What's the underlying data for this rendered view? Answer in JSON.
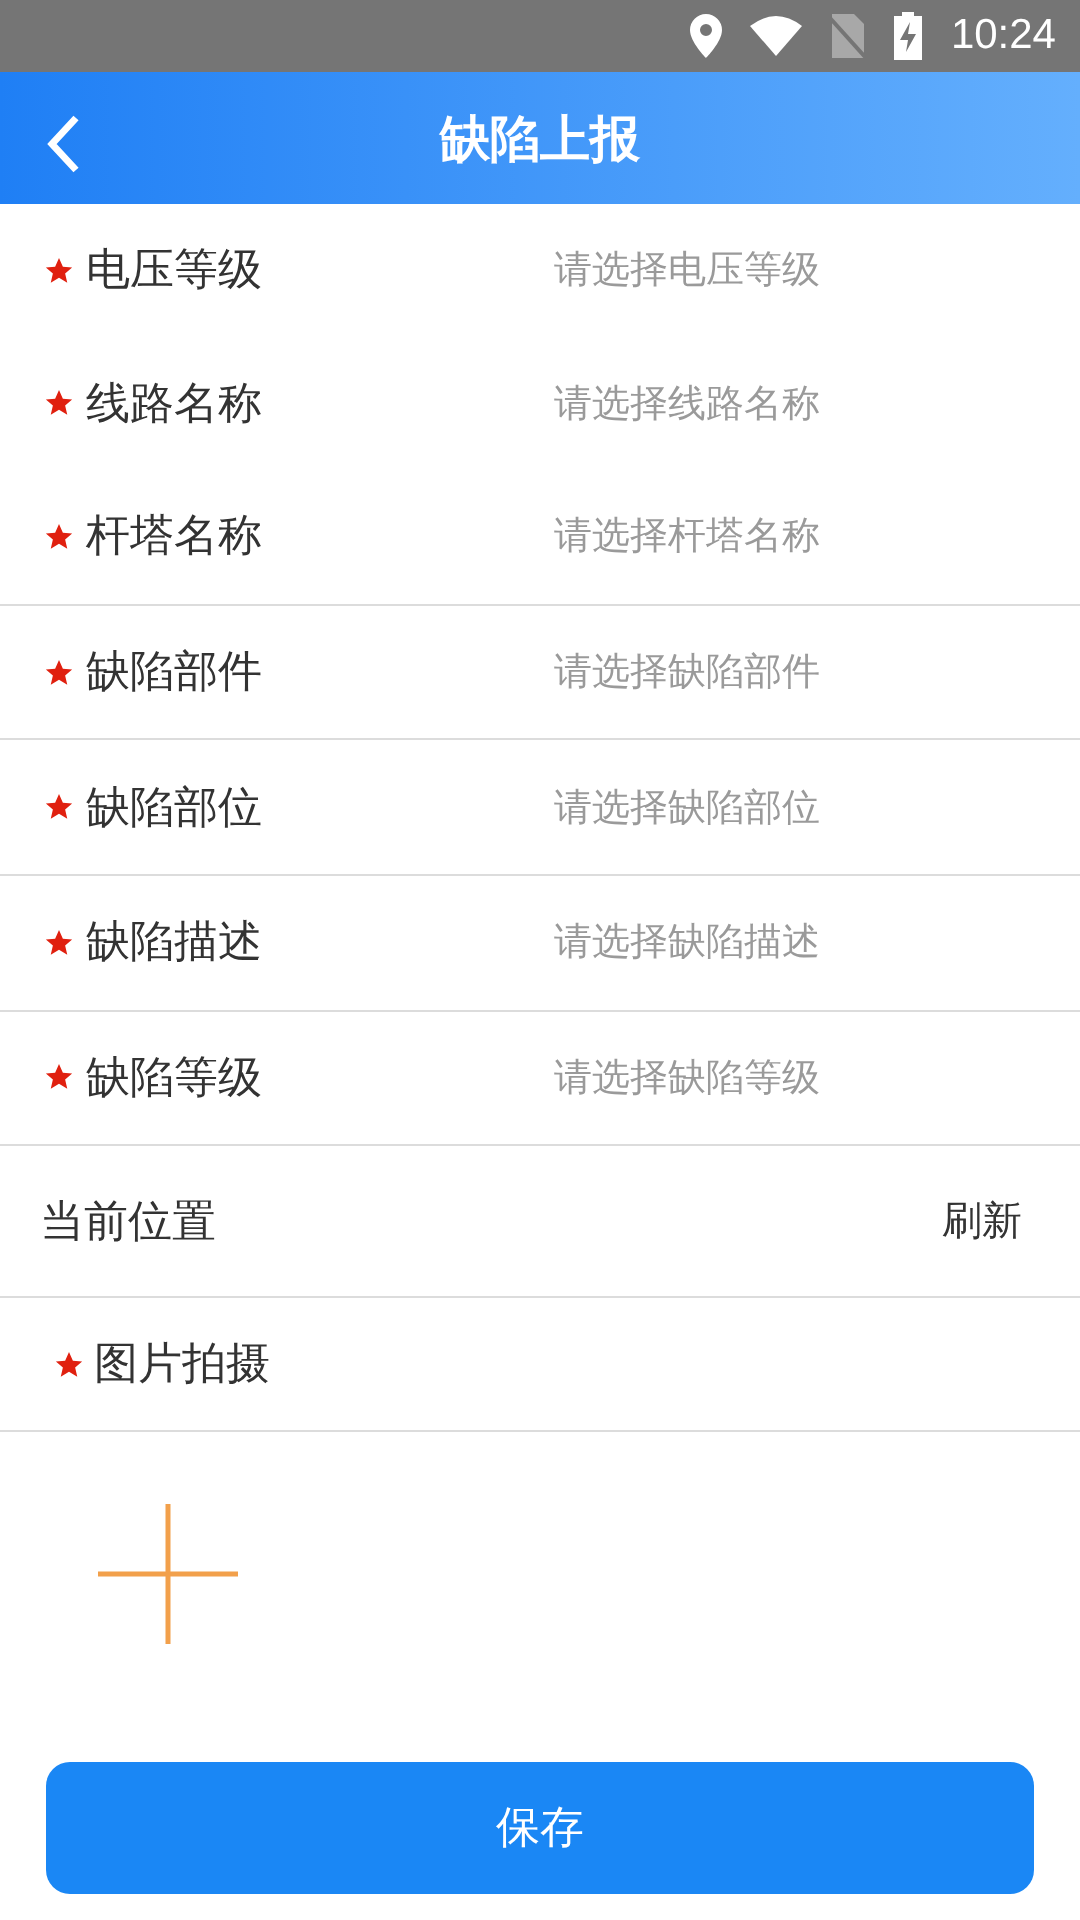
{
  "status_bar": {
    "time": "10:24"
  },
  "header": {
    "title": "缺陷上报"
  },
  "field_groups": [
    {
      "fields": [
        {
          "label": "电压等级",
          "required": true,
          "placeholder": "请选择电压等级"
        },
        {
          "label": "线路名称",
          "required": true,
          "placeholder": "请选择线路名称"
        },
        {
          "label": "杆塔名称",
          "required": true,
          "placeholder": "请选择杆塔名称"
        }
      ]
    },
    {
      "fields": [
        {
          "label": "缺陷部件",
          "required": true,
          "placeholder": "请选择缺陷部件"
        }
      ]
    },
    {
      "fields": [
        {
          "label": "缺陷部位",
          "required": true,
          "placeholder": "请选择缺陷部位"
        }
      ]
    },
    {
      "fields": [
        {
          "label": "缺陷描述",
          "required": true,
          "placeholder": "请选择缺陷描述"
        }
      ]
    },
    {
      "fields": [
        {
          "label": "缺陷等级",
          "required": true,
          "placeholder": "请选择缺陷等级"
        }
      ]
    }
  ],
  "location": {
    "label": "当前位置",
    "action": "刷新"
  },
  "photo": {
    "label": "图片拍摄",
    "required": true
  },
  "save_button": "保存"
}
